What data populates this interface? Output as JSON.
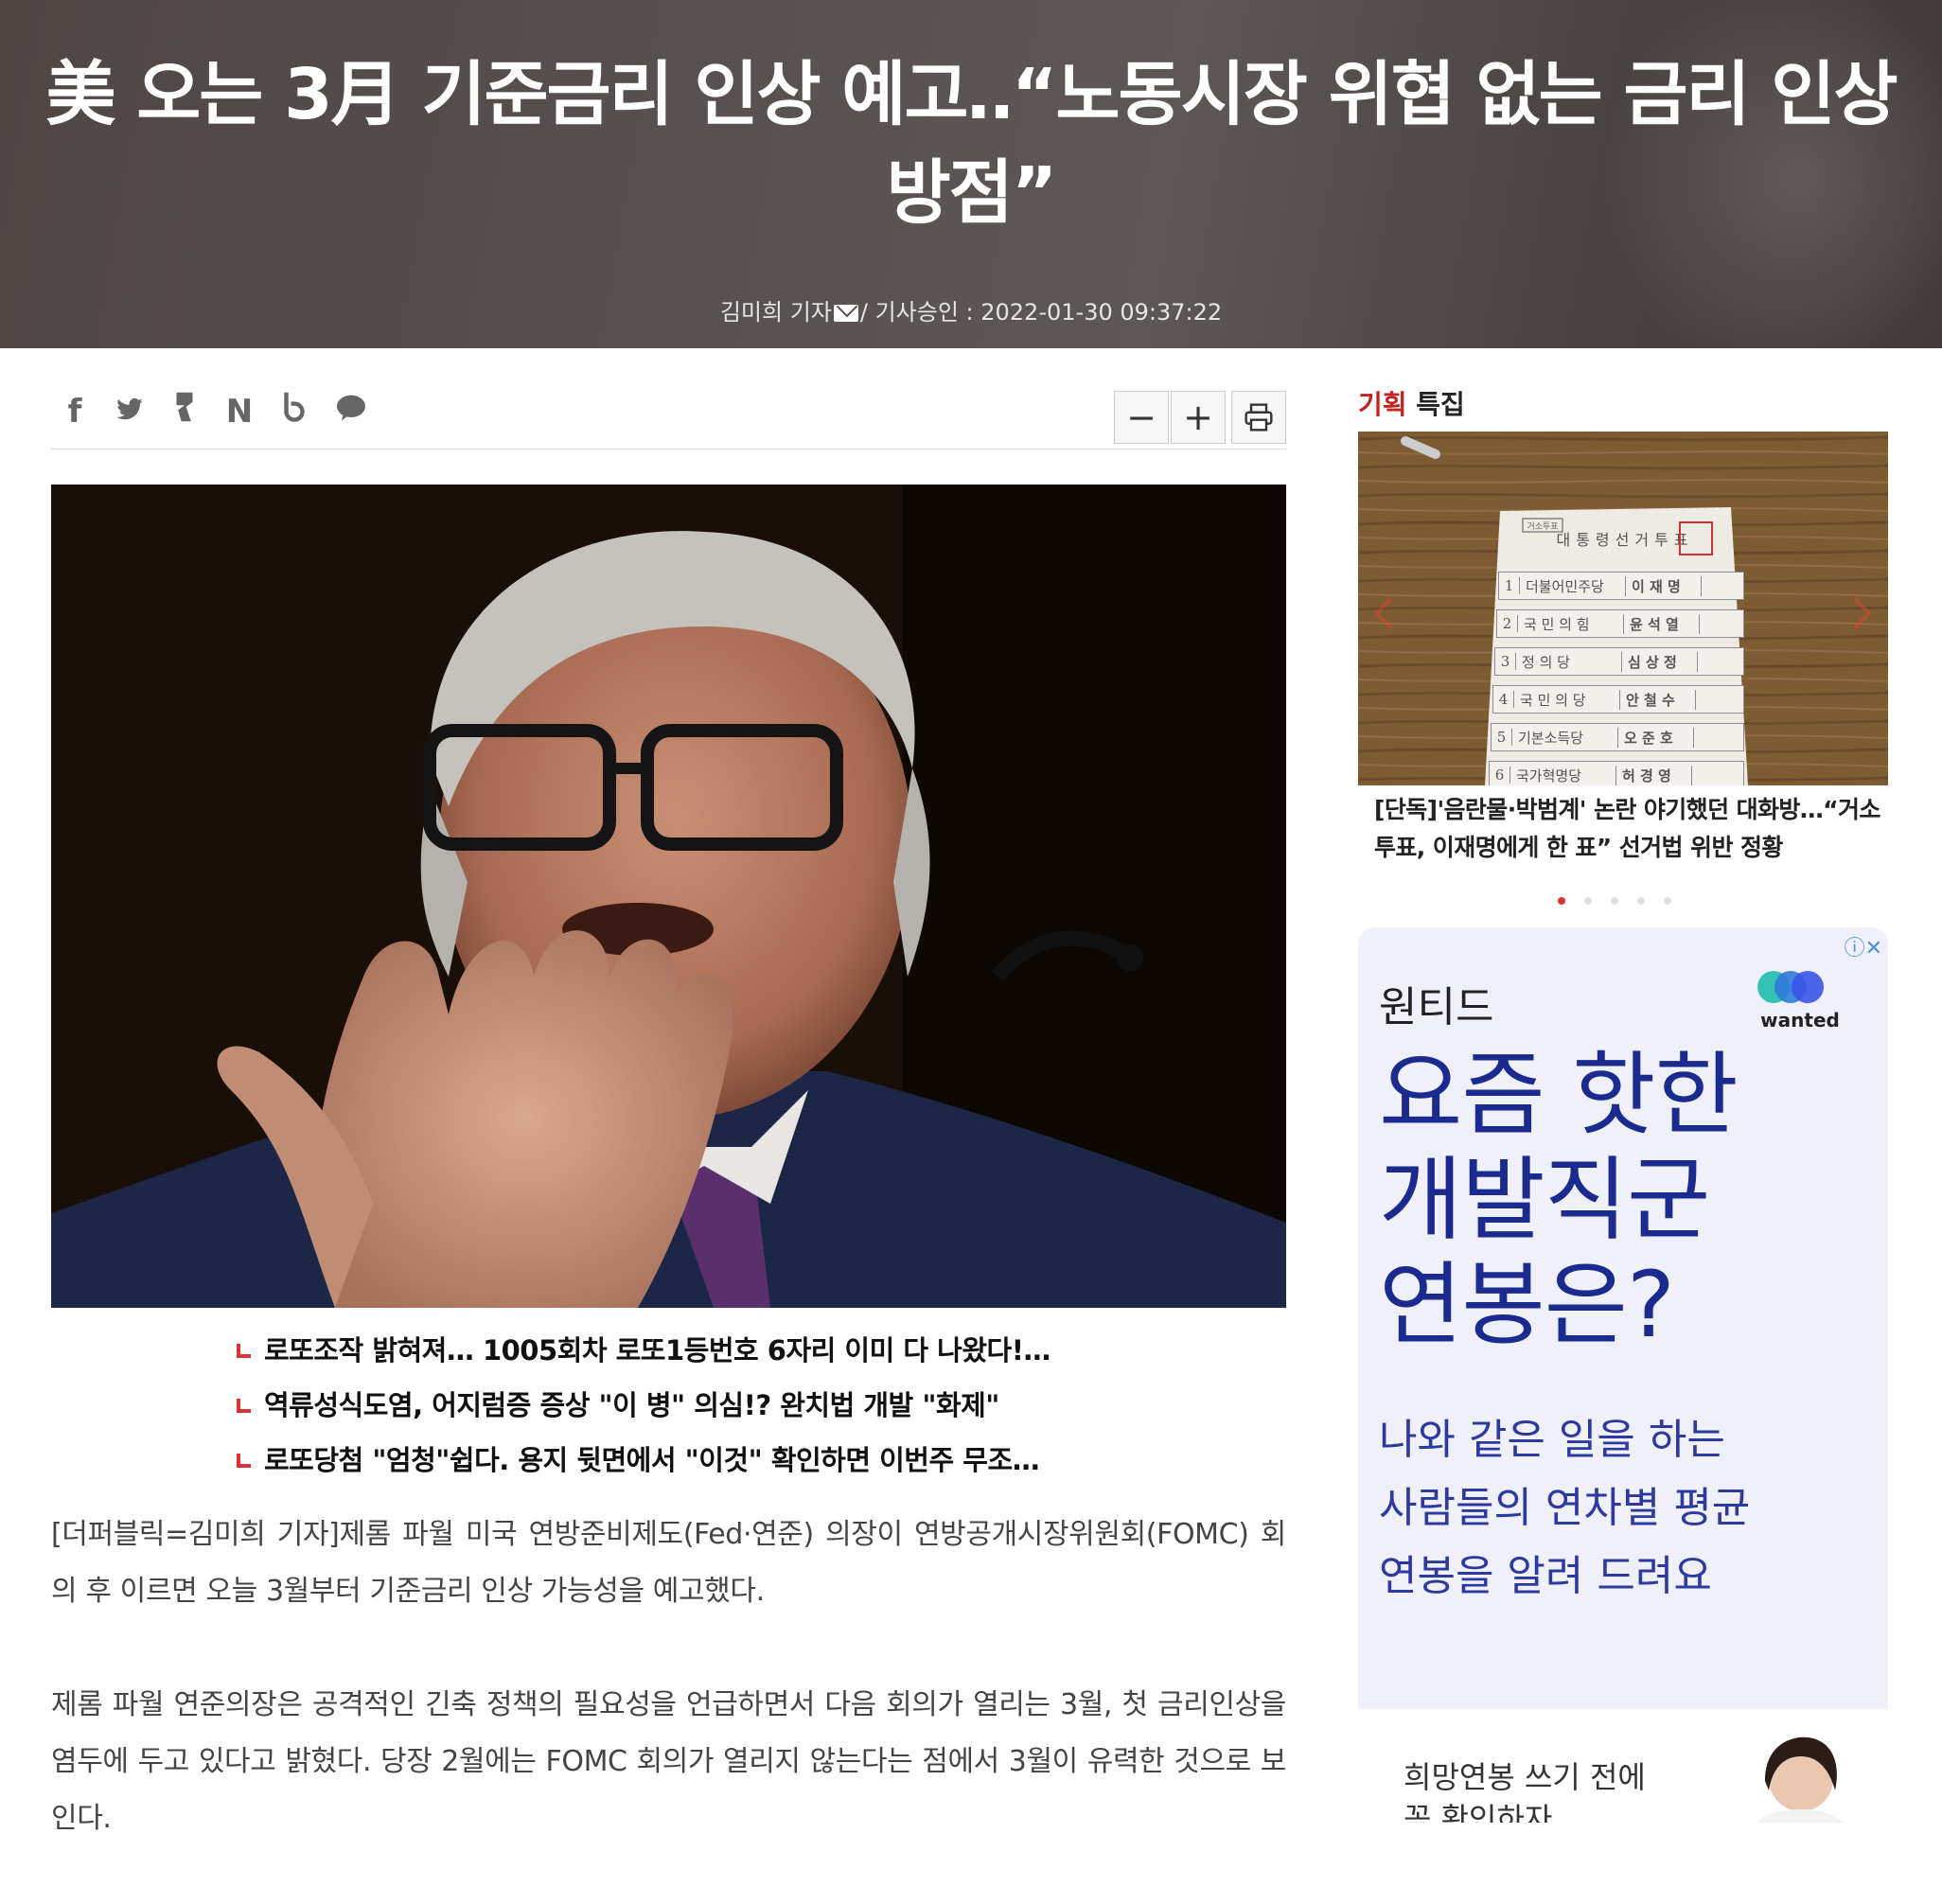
{
  "header": {
    "headline_line1": "美 오는 3月 기준금리 인상 예고‥“노동시장 위협 없는 금리 인상",
    "headline_line2": "방점”",
    "reporter": "김미희 기자",
    "approval": "/ 기사승인 : 2022-01-30 09:37:22"
  },
  "toolbar": {
    "share_icons": [
      "facebook-icon",
      "twitter-icon",
      "kakaostory-icon",
      "naver-icon",
      "band-icon",
      "kakaotalk-icon"
    ],
    "zoom_out_label": "−",
    "zoom_in_label": "+"
  },
  "related": [
    "로또조작 밝혀져… 1005회차 로또1등번호 6자리 이미 다 나왔다!…",
    "역류성식도염, 어지럼증 증상 \"이 병\" 의심!? 완치법 개발 \"화제\"",
    "로또당첨 \"엄청\"쉽다. 용지 뒷면에서 \"이것\" 확인하면 이번주 무조…"
  ],
  "body": {
    "p1": "[더퍼블릭=김미희 기자]제롬 파월 미국 연방준비제도(Fed·연준) 의장이 연방공개시장위원회(FOMC) 회의 후 이르면 오늘 3월부터 기준금리 인상 가능성을 예고했다.",
    "p2": "제롬 파월 연준의장은 공격적인 긴축 정책의 필요성을 언급하면서 다음 회의가 열리는 3월, 첫 금리인상을 염두에 두고 있다고 밝혔다. 당장 2월에는 FOMC 회의가 열리지 않는다는 점에서 3월이 유력한 것으로 보인다."
  },
  "sidebar": {
    "title_red": "기획",
    "title_rest": " 특집",
    "feature_caption": "[단독]'음란물·박범계' 논란 야기했던 대화방…“거소투표, 이재명에게 한 표” 선거법 위반 정황",
    "dots": 5,
    "active_dot": 0
  },
  "ballot": {
    "tag": "거소투표",
    "title": "대통령선거투표",
    "rows": [
      {
        "n": "1",
        "party": "더불어민주당",
        "name": "이 재 명"
      },
      {
        "n": "2",
        "party": "국 민 의 힘",
        "name": "윤 석 열"
      },
      {
        "n": "3",
        "party": "정  의  당",
        "name": "심 상 정"
      },
      {
        "n": "4",
        "party": "국 민 의 당",
        "name": "안 철 수"
      },
      {
        "n": "5",
        "party": "기본소득당",
        "name": "오 준 호"
      },
      {
        "n": "6",
        "party": "국가혁명당",
        "name": "허 경 영"
      }
    ]
  },
  "ad": {
    "close_label": "ⓘ✕",
    "brand": "원티드",
    "logo_text": "wanted",
    "headline_lines": [
      "요즘 핫한",
      "개발직군",
      "연봉은?"
    ],
    "sub_lines": [
      "나와 같은 일을 하는",
      "사람들의 연차별 평균",
      "연봉을 알려 드려요"
    ],
    "ad2_lines": [
      "희망연봉 쓰기 전에",
      "꼭 확인하자"
    ]
  },
  "colors": {
    "accent_red": "#c5221f",
    "ad_navy": "#1b2a8f",
    "ad_bg": "#eff0fa"
  }
}
